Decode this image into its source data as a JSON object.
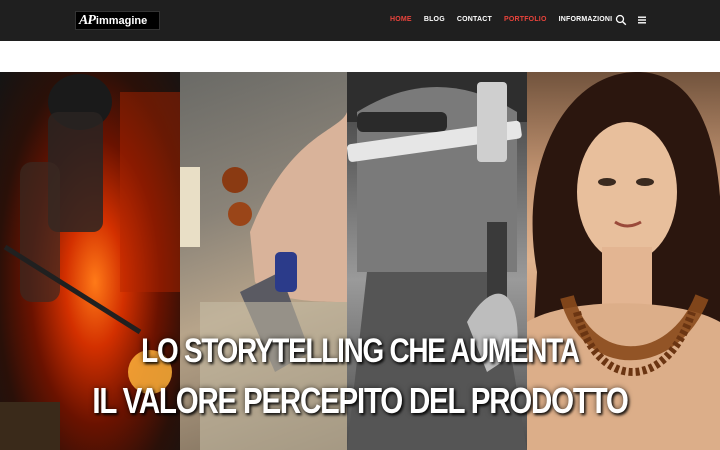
{
  "header": {
    "logo": {
      "mark": "AP",
      "text": "immagine"
    },
    "nav": [
      {
        "label": "HOME",
        "state": "active"
      },
      {
        "label": "BLOG"
      },
      {
        "label": "CONTACT"
      },
      {
        "label": "PORTFOLIO",
        "state": "highlighted"
      },
      {
        "label": "INFORMAZIONI"
      }
    ],
    "icons": [
      "search-icon",
      "menu-icon"
    ]
  },
  "hero": {
    "headline_line1": "LO STORYTELLING CHE AUMENTA",
    "headline_line2": "IL VALORE PERCEPITO DEL PRODOTTO",
    "panels": [
      "glass-furnace-worker",
      "hands-with-pliers",
      "craftsman-with-hammer",
      "woman-with-necklace"
    ]
  },
  "colors": {
    "header_bg": "#1f1f1f",
    "nav_active": "#e8433b",
    "nav_text": "#ffffff"
  }
}
